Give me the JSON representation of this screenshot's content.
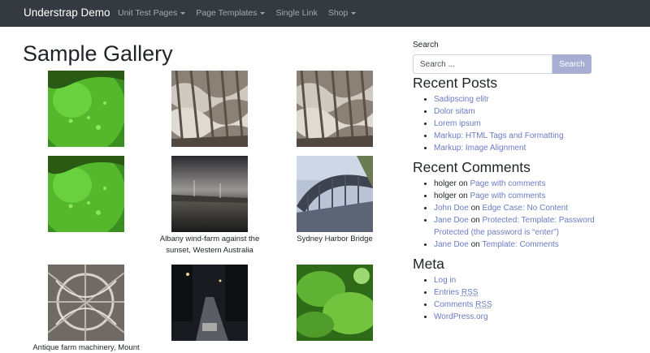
{
  "navbar": {
    "brand": "Understrap Demo",
    "items": [
      {
        "label": "Unit Test Pages",
        "dropdown": true
      },
      {
        "label": "Page Templates",
        "dropdown": true
      },
      {
        "label": "Single Link",
        "dropdown": false
      },
      {
        "label": "Shop",
        "dropdown": true
      }
    ]
  },
  "page": {
    "title": "Sample Gallery"
  },
  "gallery": {
    "captions": {
      "wind_farm": "Albany wind-farm against the sunset, Western Australia",
      "harbor": "Sydney Harbor Bridge",
      "antique": "Antique farm machinery, Mount"
    }
  },
  "sidebar": {
    "search": {
      "label": "Search",
      "placeholder": "Search ...",
      "button": "Search"
    },
    "recent_posts": {
      "title": "Recent Posts",
      "items": [
        "Sadipscing elitr",
        "Dolor sitam",
        "Lorem ipsum",
        "Markup: HTML Tags and Formatting",
        "Markup: Image Alignment"
      ]
    },
    "recent_comments": {
      "title": "Recent Comments",
      "on": "on",
      "items": [
        {
          "author": "holger",
          "post": "Page with comments"
        },
        {
          "author": "holger",
          "post": "Page with comments"
        },
        {
          "author": "John Doe",
          "post": "Edge Case: No Content"
        },
        {
          "author": "Jane Doe",
          "post": "Protected: Template: Password Protected (the password is “enter”)"
        },
        {
          "author": "Jane Doe",
          "post": "Template: Comments"
        }
      ]
    },
    "meta": {
      "title": "Meta",
      "log_in": "Log in",
      "entries_prefix": "Entries",
      "entries_abbr": "RSS",
      "comments_prefix": "Comments",
      "comments_abbr": "RSS",
      "wordpress": "WordPress.org"
    }
  },
  "colors": {
    "navbar": "#343a40",
    "link": "#6b7bc0",
    "search_button": "#a8aed2"
  }
}
